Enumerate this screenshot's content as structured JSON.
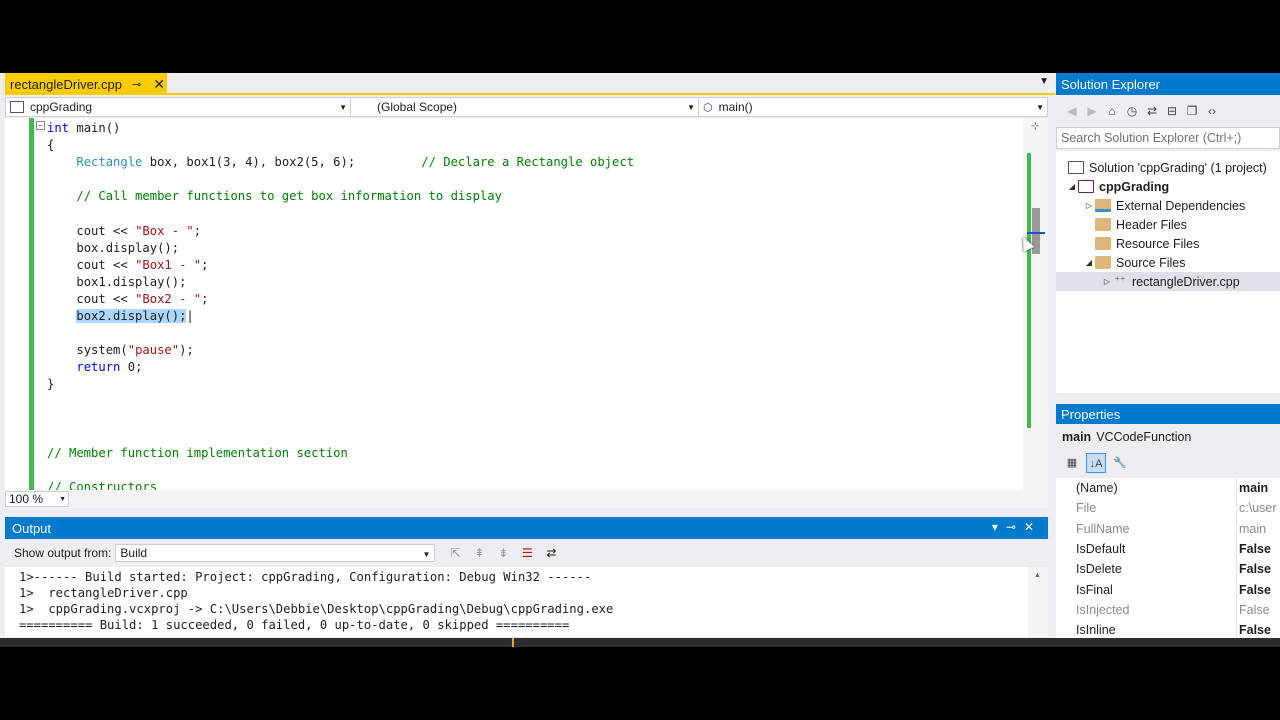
{
  "editor": {
    "tab": {
      "filename": "rectangleDriver.cpp",
      "pin_glyph": "⊸",
      "close_glyph": "✕"
    },
    "nav": {
      "project": "cppGrading",
      "scope": "(Global Scope)",
      "member": "main()"
    },
    "code": {
      "l1_kw": "int",
      "l1_rest": " main()",
      "l2": "{",
      "l3_type": "Rectangle",
      "l3_rest": " box, box1(3, 4), box2(5, 6);",
      "l3_comment": "// Declare a Rectangle object",
      "l5_comment": "// Call member functions to get box information to display",
      "l7_a": "cout << ",
      "l7_str": "\"Box - \"",
      "l7_b": ";",
      "l8": "box.display();",
      "l9_a": "cout << ",
      "l9_str": "\"Box1 - \"",
      "l9_b": ";",
      "l10": "box1.display();",
      "l11_a": "cout << ",
      "l11_str": "\"Box2 - \"",
      "l11_b": ";",
      "l12": "box2.display();",
      "l14_a": "system(",
      "l14_str": "\"pause\"",
      "l14_b": ");",
      "l15_kw": "return",
      "l15_rest": " 0;",
      "l16": "}",
      "l20_comment": "// Member function implementation section",
      "l22_comment": "// Constructors"
    },
    "zoom": "100 %"
  },
  "output": {
    "title": "Output",
    "show_from_label": "Show output from:",
    "source": "Build",
    "lines": [
      "1>------ Build started: Project: cppGrading, Configuration: Debug Win32 ------",
      "1>  rectangleDriver.cpp",
      "1>  cppGrading.vcxproj -> C:\\Users\\Debbie\\Desktop\\cppGrading\\Debug\\cppGrading.exe",
      "========== Build: 1 succeeded, 0 failed, 0 up-to-date, 0 skipped =========="
    ]
  },
  "solution_explorer": {
    "title": "Solution Explorer",
    "search_placeholder": "Search Solution Explorer (Ctrl+;)",
    "items": [
      {
        "label": "Solution 'cppGrading' (1 project)"
      },
      {
        "label": "cppGrading"
      },
      {
        "label": "External Dependencies"
      },
      {
        "label": "Header Files"
      },
      {
        "label": "Resource Files"
      },
      {
        "label": "Source Files"
      },
      {
        "label": "rectangleDriver.cpp"
      }
    ]
  },
  "properties": {
    "title": "Properties",
    "object_name": "main",
    "object_type": "VCCodeFunction",
    "rows": [
      {
        "key": "(Name)",
        "value": "main"
      },
      {
        "key": "File",
        "value": "c:\\user"
      },
      {
        "key": "FullName",
        "value": "main"
      },
      {
        "key": "IsDefault",
        "value": "False"
      },
      {
        "key": "IsDelete",
        "value": "False"
      },
      {
        "key": "IsFinal",
        "value": "False"
      },
      {
        "key": "IsInjected",
        "value": "False"
      },
      {
        "key": "IsInline",
        "value": "False"
      }
    ]
  },
  "colors": {
    "accent": "#007acc",
    "active_tab": "#ffcc00",
    "change_bar": "#3fb950"
  }
}
